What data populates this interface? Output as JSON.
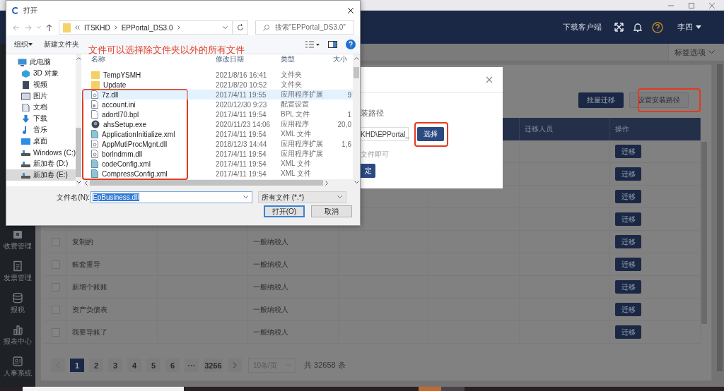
{
  "file_dialog": {
    "title": "打开",
    "path": [
      "ITSKHD",
      "EPPortal_DS3.0"
    ],
    "search_placeholder": "搜索\"EPPortal_DS3.0\"",
    "toolbar": [
      "组织",
      "新建文件夹"
    ],
    "nav_items": [
      {
        "label": "此电脑",
        "selected": false,
        "children": [
          {
            "label": "3D 对象",
            "selected": false
          },
          {
            "label": "视频",
            "selected": false
          },
          {
            "label": "图片",
            "selected": false
          },
          {
            "label": "文档",
            "selected": false
          },
          {
            "label": "下载",
            "selected": false
          },
          {
            "label": "音乐",
            "selected": false
          },
          {
            "label": "桌面",
            "selected": false
          },
          {
            "label": "Windows (C:)",
            "selected": false
          },
          {
            "label": "新加卷 (D:)",
            "selected": false
          },
          {
            "label": "新加卷 (E:)",
            "selected": true
          }
        ]
      }
    ],
    "columns": [
      "名称",
      "修改日期",
      "类型",
      "大小"
    ],
    "files": [
      {
        "name": "TempYSMH",
        "modified": "2021/8/16 16:41",
        "type": "文件夹",
        "kind": "folder",
        "selected": false
      },
      {
        "name": "Update",
        "modified": "2021/8/20 10:52",
        "type": "文件夹",
        "kind": "folder",
        "selected": false
      },
      {
        "name": "7z.dll",
        "modified": "2017/4/11 19:55",
        "type": "应用程序扩展",
        "size": "9",
        "kind": "dll",
        "selected": true
      },
      {
        "name": "account.ini",
        "modified": "2020/12/30 9:23",
        "type": "配置设置",
        "kind": "ini",
        "selected": false
      },
      {
        "name": "adortl70.bpl",
        "modified": "2017/4/11 19:54",
        "type": "BPL 文件",
        "size": "1",
        "kind": "file",
        "selected": false
      },
      {
        "name": "ahsSetup.exe",
        "modified": "2020/11/23 14:06",
        "type": "应用程序",
        "size": "20,0",
        "kind": "exe",
        "selected": false
      },
      {
        "name": "ApplicationInitialize.xml",
        "modified": "2017/4/11 19:54",
        "type": "XML 文件",
        "kind": "xml",
        "selected": false
      },
      {
        "name": "AppMutiProcMgnt.dll",
        "modified": "2018/12/3 14:44",
        "type": "应用程序扩展",
        "size": "1,6",
        "kind": "dll",
        "selected": false
      },
      {
        "name": "borlndmm.dll",
        "modified": "2017/4/11 19:54",
        "type": "应用程序扩展",
        "kind": "dll",
        "selected": false
      },
      {
        "name": "codeConfig.xml",
        "modified": "2017/4/11 19:54",
        "type": "XML 文件",
        "kind": "xml",
        "selected": false
      },
      {
        "name": "CompressConfig.xml",
        "modified": "2017/4/11 19:54",
        "type": "XML 文件",
        "kind": "xml",
        "selected": false
      }
    ],
    "file_name_label": "文件名(N):",
    "file_name": "EpBusiness.dll",
    "file_type": "所有文件 (*.*)",
    "open_button": "打开(O)",
    "cancel_button": "取消"
  },
  "note": "文件可以选择除文件夹以外的所有文件",
  "header": {
    "download_link": "下载客户端",
    "user": "李四"
  },
  "tab_bar": {
    "options_label": "标签选项"
  },
  "install_dialog": {
    "path_label": "装路径",
    "path_value": "KHD\\EPPortal_",
    "choose_button": "选择",
    "hint": "文件即可",
    "confirm_button": "定"
  },
  "toolbar": [
    {
      "label": "批量迁移",
      "kind": "primary"
    },
    {
      "label": "设置安装路径",
      "kind": "default"
    }
  ],
  "table": {
    "columns": [
      "迁移人员",
      "操作"
    ],
    "rows": [
      {
        "action": "迁移"
      },
      {
        "action": "迁移"
      },
      {
        "action": "迁移"
      },
      {
        "action": "迁移"
      },
      {
        "name": "复制的",
        "taxpayer_type": "一般纳税人",
        "checked": false,
        "action": "迁移"
      },
      {
        "name": "账套重导",
        "taxpayer_type": "一般纳税人",
        "checked": false,
        "action": "迁移"
      },
      {
        "name": "新增个账账",
        "taxpayer_type": "一般纳税人",
        "checked": false,
        "action": "迁移"
      },
      {
        "name": "资产负债表",
        "taxpayer_type": "一般纳税人",
        "checked": false,
        "action": "迁移"
      },
      {
        "name": "我要导账了",
        "taxpayer_type": "一般纳税人",
        "checked": false,
        "action": "迁移"
      }
    ]
  },
  "pagination": {
    "pages": [
      {
        "label": "1",
        "selected": true
      },
      {
        "label": "2",
        "selected": false
      },
      {
        "label": "3",
        "selected": false
      },
      {
        "label": "4",
        "selected": false
      },
      {
        "label": "5",
        "selected": false
      },
      {
        "label": "6",
        "selected": false
      },
      {
        "label": "···",
        "selected": false
      },
      {
        "label": "3266",
        "selected": false
      }
    ],
    "page_size": "10条/页",
    "total": "共 32658 条"
  },
  "sidebar": {
    "items": [
      {
        "label": "收费管理"
      },
      {
        "label": "发票管理"
      },
      {
        "label": "报税"
      },
      {
        "label": "报表中心"
      },
      {
        "label": "人事系统"
      }
    ]
  }
}
